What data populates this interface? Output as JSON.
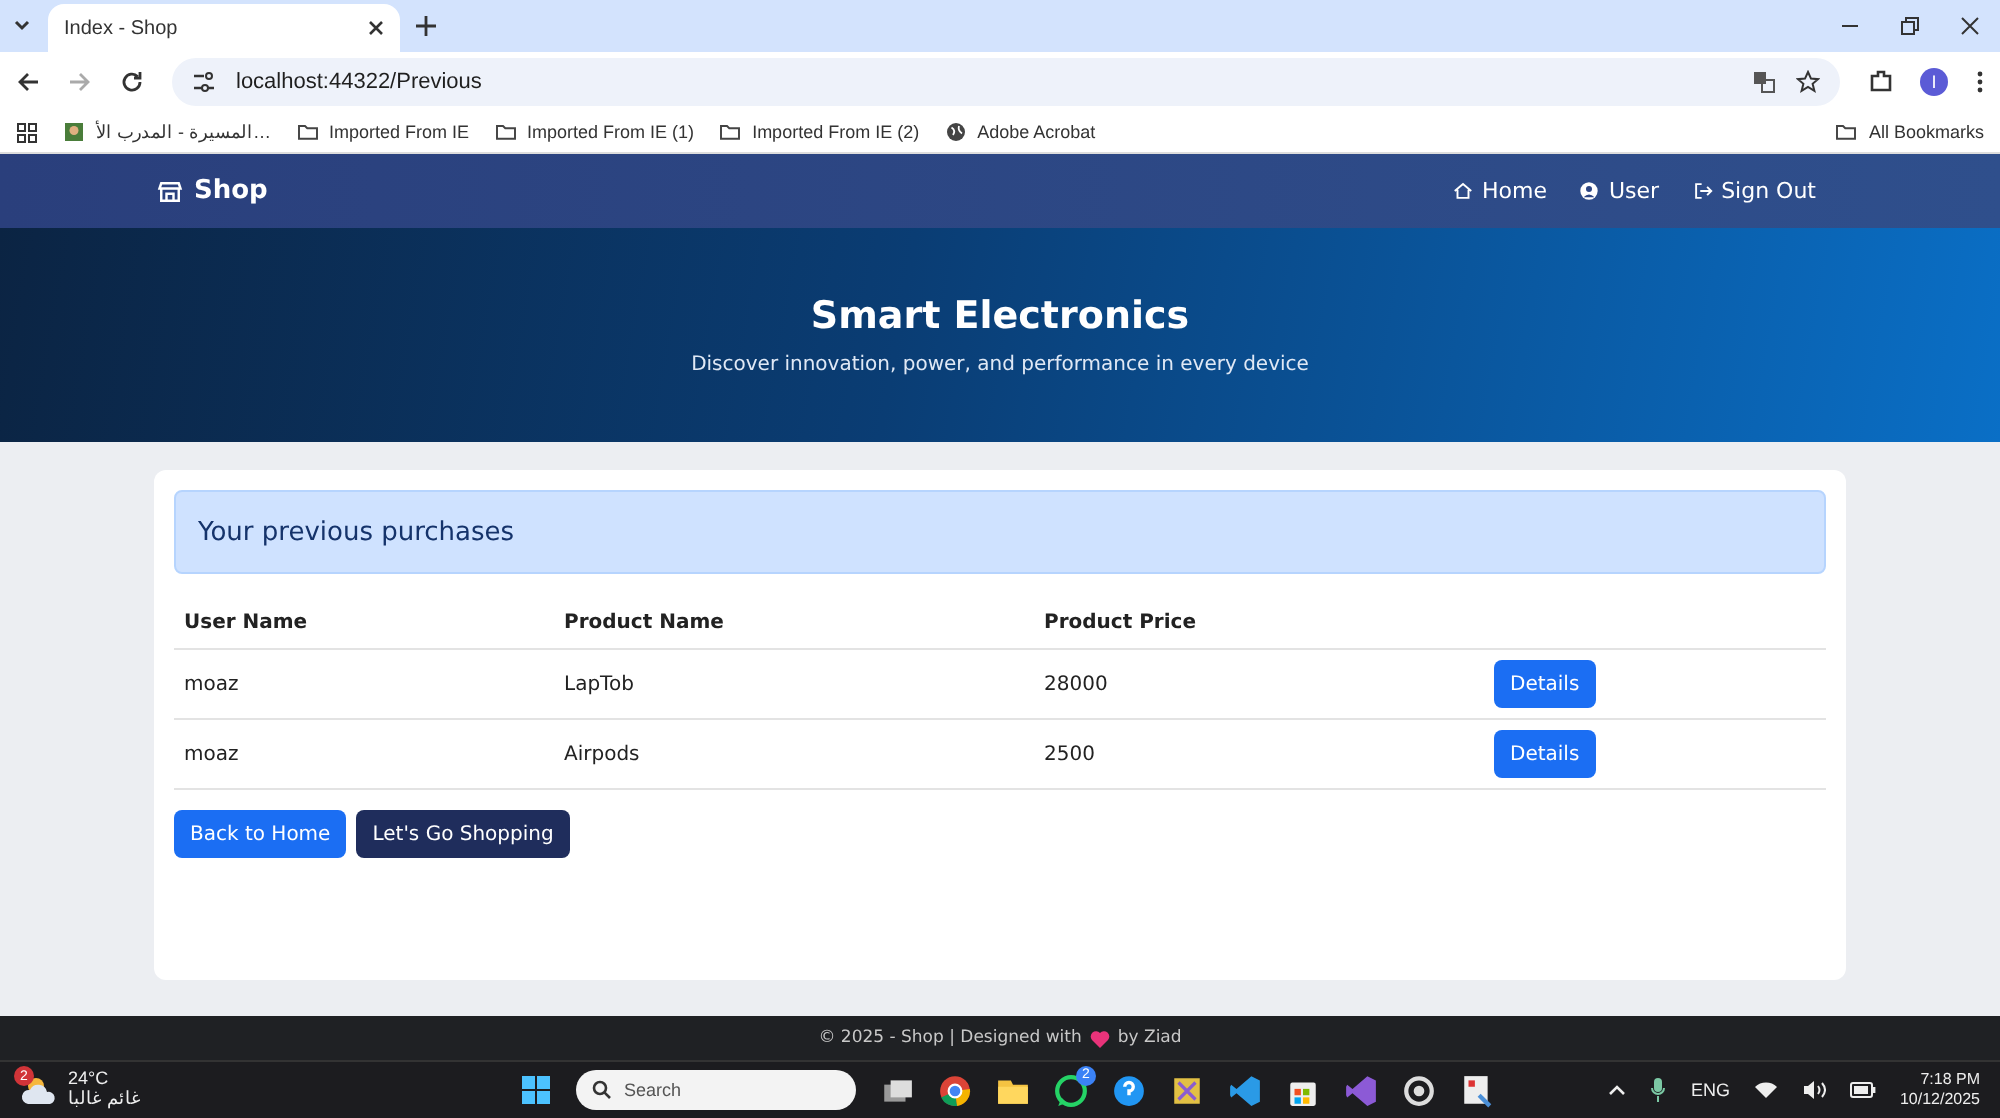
{
  "browser": {
    "tab": {
      "title": "Index - Shop"
    },
    "url": "localhost:44322/Previous",
    "profile": "I",
    "bookmarks": [
      {
        "kind": "site",
        "label": "المسيرة - المدرب الأ…"
      },
      {
        "kind": "folder",
        "label": "Imported From IE"
      },
      {
        "kind": "folder",
        "label": "Imported From IE (1)"
      },
      {
        "kind": "folder",
        "label": "Imported From IE (2)"
      },
      {
        "kind": "globe",
        "label": "Adobe Acrobat"
      }
    ],
    "all_bookmarks": "All Bookmarks"
  },
  "navbar": {
    "brand": "Shop",
    "links": [
      {
        "kind": "home",
        "label": "Home"
      },
      {
        "kind": "user",
        "label": "User"
      },
      {
        "kind": "signout",
        "label": "Sign Out"
      }
    ]
  },
  "hero": {
    "title": "Smart Electronics",
    "subtitle": "Discover innovation, power, and performance in every device"
  },
  "purchases": {
    "heading": "Your previous purchases",
    "columns": [
      "User Name",
      "Product Name",
      "Product Price"
    ],
    "rows": [
      {
        "user": "moaz",
        "product": "LapTob",
        "price": "28000",
        "action": "Details"
      },
      {
        "user": "moaz",
        "product": "Airpods",
        "price": "2500",
        "action": "Details"
      }
    ],
    "buttons": [
      {
        "kind": "primary",
        "label": "Back to Home"
      },
      {
        "kind": "dark",
        "label": "Let's Go Shopping"
      }
    ]
  },
  "footer": {
    "before": "© 2025 - Shop | Designed with",
    "after": "by Ziad"
  },
  "taskbar": {
    "weather": {
      "badge": "2",
      "temp": "24°C",
      "condition": "غائم غالبا"
    },
    "search": {
      "placeholder": "Search"
    },
    "apps": [
      {
        "kind": "taskview"
      },
      {
        "kind": "chrome"
      },
      {
        "kind": "folder"
      },
      {
        "kind": "whatsapp",
        "badge": "2"
      },
      {
        "kind": "help"
      },
      {
        "kind": "snip"
      },
      {
        "kind": "vscode"
      },
      {
        "kind": "store"
      },
      {
        "kind": "vs"
      },
      {
        "kind": "ai"
      },
      {
        "kind": "tool"
      }
    ],
    "language": "ENG",
    "time": "7:18 PM",
    "date": "10/12/2025"
  }
}
